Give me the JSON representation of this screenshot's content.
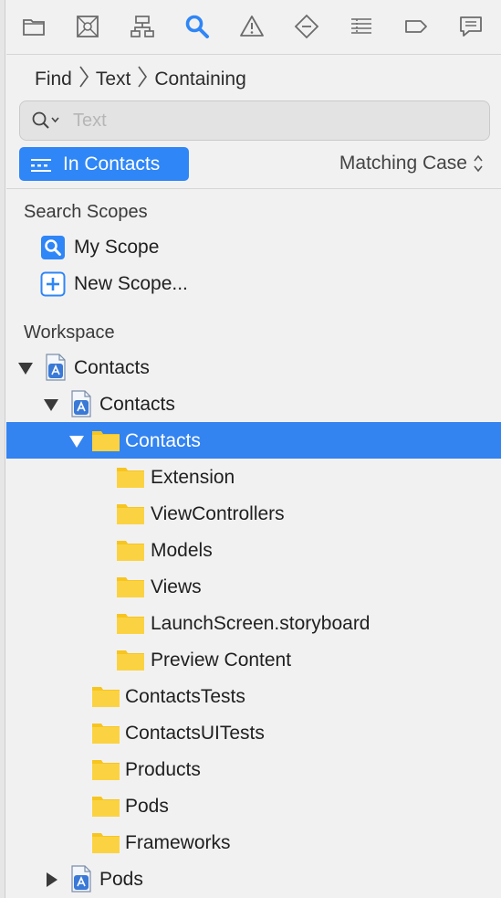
{
  "toolbar": {
    "icons": [
      "folder-icon",
      "source-control-icon",
      "hierarchy-icon",
      "search-icon",
      "warning-icon",
      "diamond-icon",
      "list-icon",
      "tag-icon",
      "report-icon"
    ],
    "active": "search-icon",
    "accent": "#2f86f6"
  },
  "breadcrumb": [
    "Find",
    "Text",
    "Containing"
  ],
  "search": {
    "value": "",
    "placeholder": "Text"
  },
  "scope_button": {
    "label": "In Contacts"
  },
  "matching": {
    "label": "Matching Case"
  },
  "search_scopes": {
    "title": "Search Scopes",
    "items": [
      {
        "label": "My Scope",
        "icon": "magnifier-scope-icon"
      },
      {
        "label": "New Scope...",
        "icon": "plus-icon"
      }
    ]
  },
  "workspace": {
    "title": "Workspace",
    "tree": [
      {
        "label": "Contacts",
        "level": 0,
        "kind": "project",
        "disclosure": "open",
        "selected": false
      },
      {
        "label": "Contacts",
        "level": 1,
        "kind": "project",
        "disclosure": "open",
        "selected": false
      },
      {
        "label": "Contacts",
        "level": 2,
        "kind": "folder",
        "disclosure": "open",
        "selected": true
      },
      {
        "label": "Extension",
        "level": 3,
        "kind": "folder",
        "disclosure": "none",
        "selected": false
      },
      {
        "label": "ViewControllers",
        "level": 3,
        "kind": "folder",
        "disclosure": "none",
        "selected": false
      },
      {
        "label": "Models",
        "level": 3,
        "kind": "folder",
        "disclosure": "none",
        "selected": false
      },
      {
        "label": "Views",
        "level": 3,
        "kind": "folder",
        "disclosure": "none",
        "selected": false
      },
      {
        "label": "LaunchScreen.storyboard",
        "level": 3,
        "kind": "folder",
        "disclosure": "none",
        "selected": false
      },
      {
        "label": "Preview Content",
        "level": 3,
        "kind": "folder",
        "disclosure": "none",
        "selected": false
      },
      {
        "label": "ContactsTests",
        "level": 2,
        "kind": "folder",
        "disclosure": "none",
        "selected": false
      },
      {
        "label": "ContactsUITests",
        "level": 2,
        "kind": "folder",
        "disclosure": "none",
        "selected": false
      },
      {
        "label": "Products",
        "level": 2,
        "kind": "folder",
        "disclosure": "none",
        "selected": false
      },
      {
        "label": "Pods",
        "level": 2,
        "kind": "folder",
        "disclosure": "none",
        "selected": false
      },
      {
        "label": "Frameworks",
        "level": 2,
        "kind": "folder",
        "disclosure": "none",
        "selected": false
      },
      {
        "label": "Pods",
        "level": 1,
        "kind": "project",
        "disclosure": "closed",
        "selected": false
      }
    ]
  },
  "colors": {
    "folder": "#f7c51f",
    "selection": "#3383f0",
    "project_icon": "#3a79d6"
  }
}
